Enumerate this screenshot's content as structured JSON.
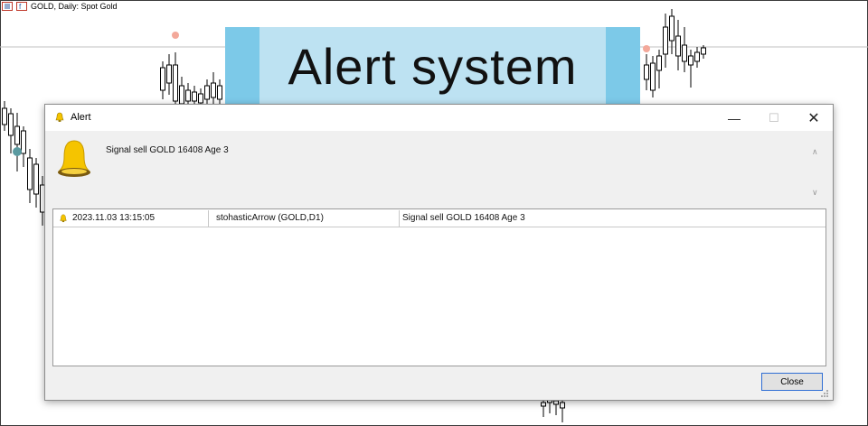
{
  "chart": {
    "symbol_label": "GOLD, Daily:  Spot Gold",
    "colors": {
      "candle": "#000000",
      "level_line": "#c0c0c0",
      "marker_red": "#f3a89a",
      "marker_teal": "#5a9aa0"
    },
    "icons": [
      "bar-chart-icon",
      "indicator-icon"
    ]
  },
  "banner": {
    "text": "Alert system",
    "colors": {
      "fill": "#bde2f2",
      "side_blocks": "#7cc9e8"
    }
  },
  "dialog": {
    "title": "Alert",
    "message": "Signal sell GOLD 16408 Age 3",
    "window_buttons": {
      "minimize": "minimize-icon",
      "maximize": "maximize-icon",
      "close": "close-icon"
    },
    "rows": [
      {
        "time": "2023.11.03 13:15:05",
        "source": "stohasticArrow (GOLD,D1)",
        "text": "Signal sell GOLD 16408 Age 3"
      }
    ],
    "close_label": "Close",
    "colors": {
      "bell": "#f5c400",
      "accent": "#2f6ed4"
    }
  }
}
